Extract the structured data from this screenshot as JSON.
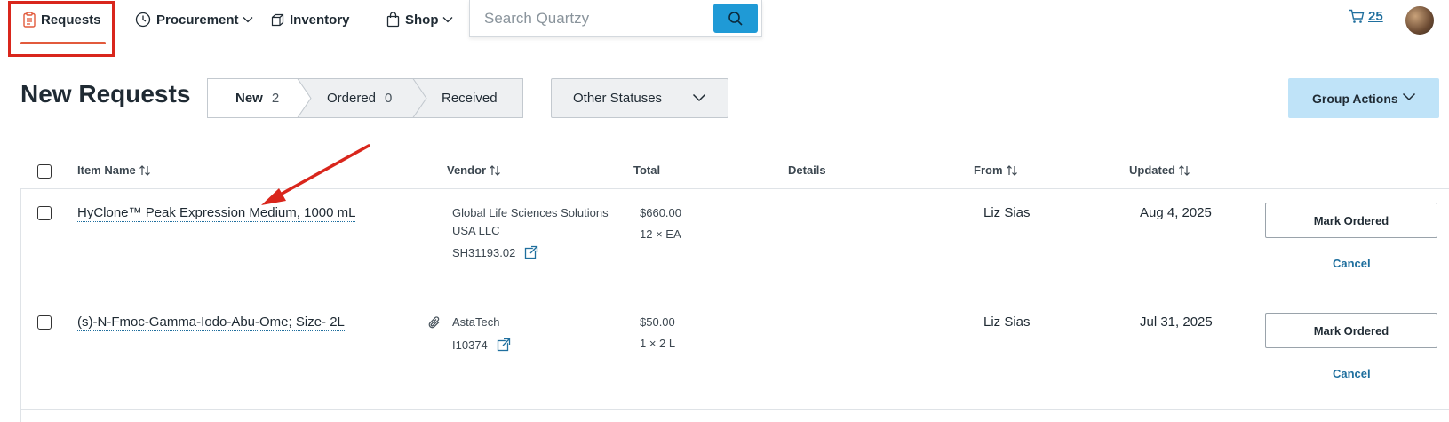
{
  "nav": {
    "requests": "Requests",
    "procurement": "Procurement",
    "inventory": "Inventory",
    "shop": "Shop",
    "search_placeholder": "Search Quartzy",
    "cart_count": "25"
  },
  "page": {
    "title": "New Requests",
    "tabs": [
      {
        "label": "New",
        "count": "2"
      },
      {
        "label": "Ordered",
        "count": "0"
      },
      {
        "label": "Received",
        "count": ""
      }
    ],
    "other_statuses": "Other Statuses",
    "group_actions": "Group Actions"
  },
  "table": {
    "headers": {
      "item_name": "Item Name",
      "vendor": "Vendor",
      "total": "Total",
      "details": "Details",
      "from": "From",
      "updated": "Updated"
    },
    "rows": [
      {
        "item": "HyClone™ Peak Expression Medium, 1000 mL",
        "vendor_line1": "Global Life Sciences Solutions",
        "vendor_line2": "USA LLC",
        "catalog": "SH31193.02",
        "price": "$660.00",
        "qty": "12 × EA",
        "from": "Liz Sias",
        "updated": "Aug 4, 2025",
        "mark_label": "Mark Ordered",
        "cancel_label": "Cancel"
      },
      {
        "item": "(s)-N-Fmoc-Gamma-Iodo-Abu-Ome; Size- 2L",
        "vendor_line1": "AstaTech",
        "vendor_line2": "",
        "catalog": "I10374",
        "price": "$50.00",
        "qty": "1 × 2 L",
        "from": "Liz Sias",
        "updated": "Jul 31, 2025",
        "mark_label": "Mark Ordered",
        "cancel_label": "Cancel"
      }
    ]
  },
  "colors": {
    "accent_blue": "#1f9ad6",
    "link_blue": "#1f6f9e",
    "highlight_red": "#d9261c",
    "group_actions_bg": "#bfe3f8"
  },
  "icons": [
    "clipboard-icon",
    "clock-icon",
    "box-icon",
    "bag-icon",
    "search-icon",
    "cart-icon",
    "chevron-down-icon",
    "sort-icon",
    "external-link-icon",
    "paperclip-icon"
  ]
}
